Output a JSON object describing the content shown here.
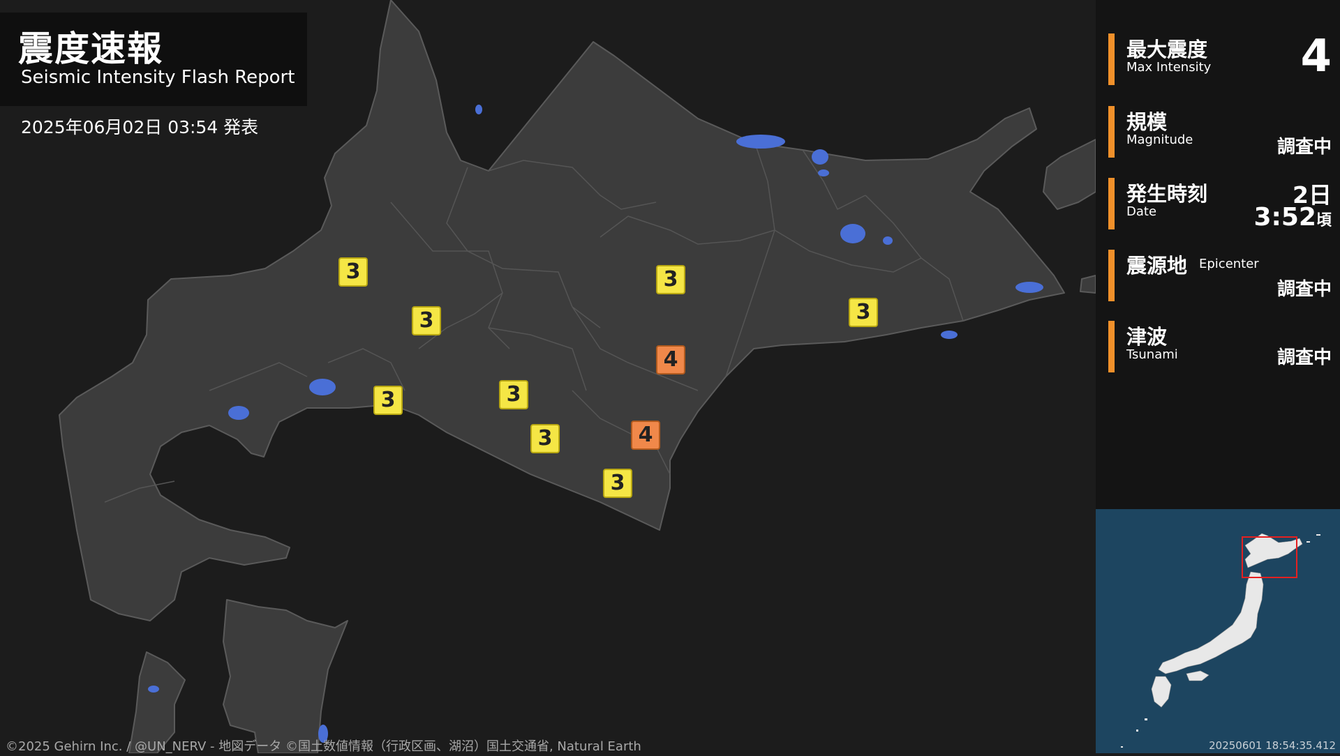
{
  "header": {
    "title_ja": "震度速報",
    "title_en": "Seismic Intensity Flash Report",
    "issued": "2025年06月02日 03:54 発表"
  },
  "info": {
    "max_intensity": {
      "label_ja": "最大震度",
      "label_en": "Max Intensity",
      "value": "4"
    },
    "magnitude": {
      "label_ja": "規模",
      "label_en": "Magnitude",
      "value": "調査中"
    },
    "date": {
      "label_ja": "発生時刻",
      "label_en": "Date",
      "day": "2日",
      "time": "3:52",
      "suffix": "頃"
    },
    "epicenter": {
      "label_ja": "震源地",
      "label_en": "Epicenter",
      "value": "調査中"
    },
    "tsunami": {
      "label_ja": "津波",
      "label_en": "Tsunami",
      "value": "調査中"
    }
  },
  "markers": [
    {
      "value": "3"
    },
    {
      "value": "3"
    },
    {
      "value": "3"
    },
    {
      "value": "3"
    },
    {
      "value": "3"
    },
    {
      "value": "3"
    },
    {
      "value": "3"
    },
    {
      "value": "3"
    },
    {
      "value": "4"
    },
    {
      "value": "4"
    }
  ],
  "colors": {
    "intensity_3": "#f5e645",
    "intensity_4": "#f0884a",
    "land": "#3c3c3c",
    "sea": "#1c1c1c",
    "lake": "#4a6fd6",
    "accent": "#f0902a",
    "inset_sea": "#1d4560",
    "inset_frame": "#e52020"
  },
  "inset": {
    "timestamp": "20250601 18:54:35.412"
  },
  "credit": "©2025 Gehirn Inc. / @UN_NERV - 地図データ ©国土数値情報（行政区画、湖沼）国土交通省, Natural Earth"
}
